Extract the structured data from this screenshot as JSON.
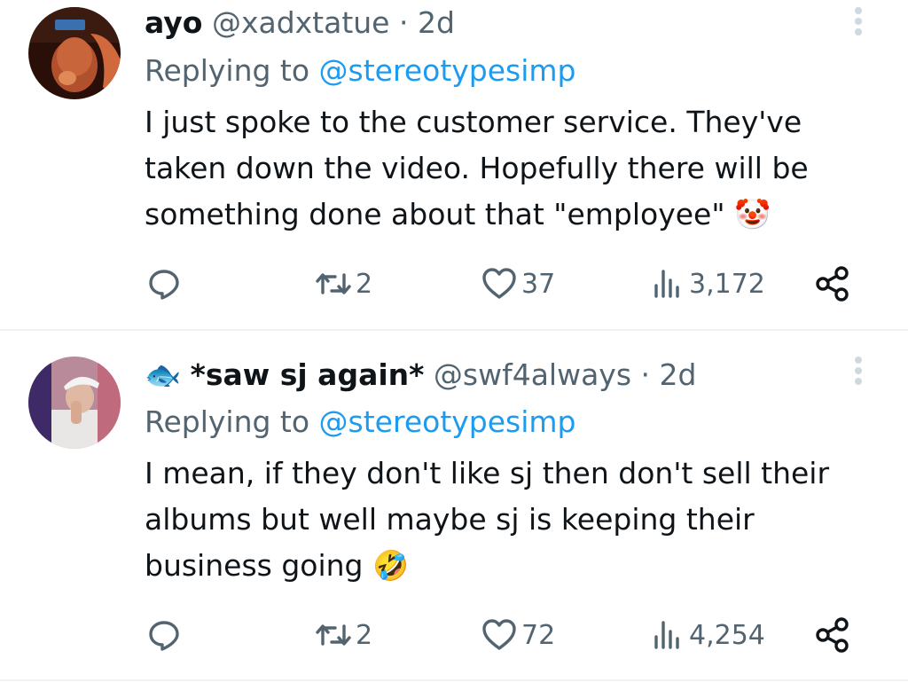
{
  "tweets": [
    {
      "display_name": "ayo",
      "handle": "@xadxtatue",
      "separator": "·",
      "time": "2d",
      "replying_label": "Replying to",
      "replying_to": "@stereotypesimp",
      "text": "I just spoke to the customer service. They've taken down the video. Hopefully there will be something done about that \"employee\" 🤡",
      "retweets": "2",
      "likes": "37",
      "views": "3,172"
    },
    {
      "name_emoji": "🐟",
      "display_name": "*saw sj again*",
      "handle": "@swf4always",
      "separator": "·",
      "time": "2d",
      "replying_label": "Replying to",
      "replying_to": "@stereotypesimp",
      "text": "I mean, if they don't like sj then don't sell their albums but well maybe sj is keeping their business going 🤣",
      "retweets": "2",
      "likes": "72",
      "views": "4,254"
    }
  ],
  "icons": {
    "reply": "reply-icon",
    "retweet": "retweet-icon",
    "like": "heart-icon",
    "views": "views-icon",
    "share": "share-icon",
    "more": "more-vertical-icon"
  },
  "colors": {
    "text": "#0f1419",
    "secondary": "#536471",
    "link": "#1d9bf0",
    "divider": "#eff3f4"
  }
}
